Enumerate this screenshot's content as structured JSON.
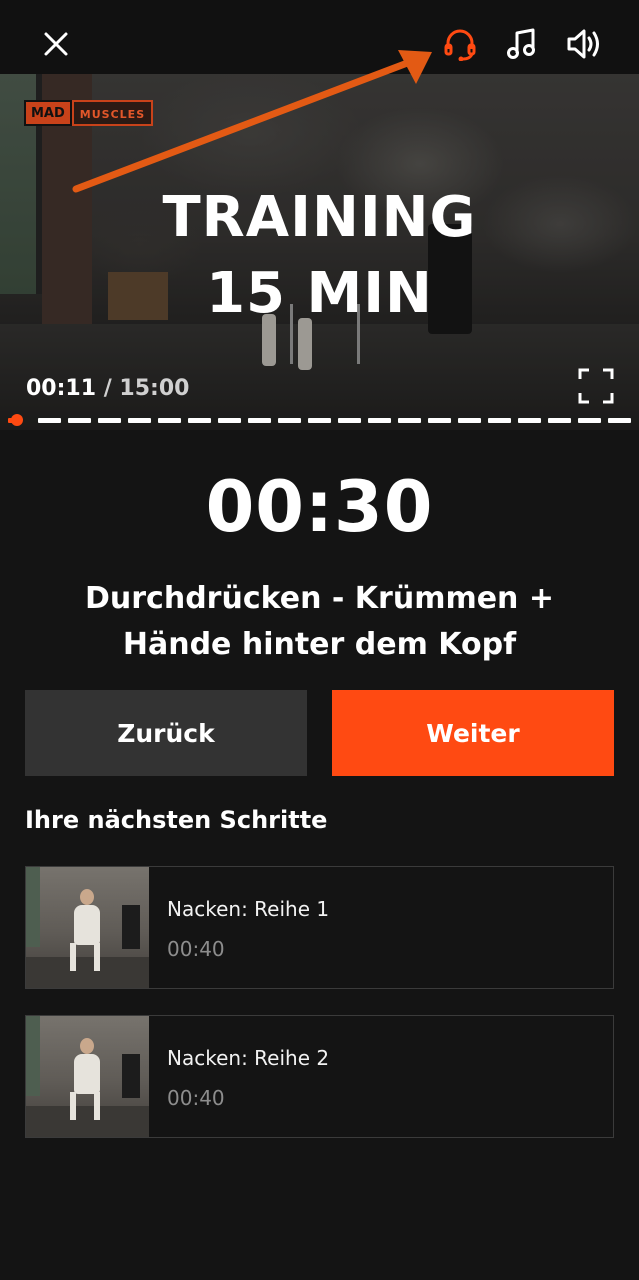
{
  "header": {
    "close_icon": "close-icon",
    "headset_icon": "headset-icon",
    "music_icon": "music-note-icon",
    "volume_icon": "volume-icon",
    "accent_color": "#ff4a12"
  },
  "video": {
    "logo_left": "MAD",
    "logo_right": "MUSCLES",
    "title_line1": "TRAINING",
    "title_line2": "15 MIN",
    "current_time": "00:11",
    "separator": "/",
    "total_time": "15:00",
    "fullscreen_icon": "fullscreen-icon",
    "progress_fraction": 0.012
  },
  "timer": "00:30",
  "exercise": {
    "line1": "Durchdrücken - Krümmen +",
    "line2": "Hände hinter dem Kopf"
  },
  "buttons": {
    "back": "Zurück",
    "next": "Weiter"
  },
  "next_steps": {
    "heading": "Ihre nächsten Schritte",
    "items": [
      {
        "title": "Nacken: Reihe 1",
        "duration": "00:40"
      },
      {
        "title": "Nacken: Reihe 2",
        "duration": "00:40"
      }
    ]
  }
}
